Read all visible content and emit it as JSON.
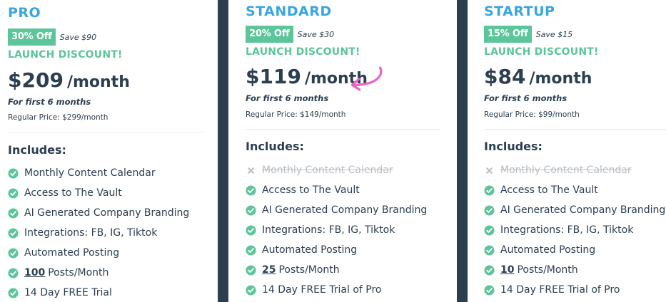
{
  "plans": [
    {
      "name": "PRO",
      "discount_badge": "30% Off",
      "save_text": "Save $90",
      "launch": "LAUNCH DISCOUNT!",
      "price": "$209",
      "per": "/month",
      "first_months": "For first 6 months",
      "regular": "Regular Price: $299/month",
      "includes": "Includes:",
      "features": [
        {
          "label": "Monthly Content Calendar",
          "enabled": true
        },
        {
          "label": "Access to The Vault",
          "enabled": true
        },
        {
          "label": "AI Generated Company Branding",
          "enabled": true
        },
        {
          "label": "Integrations: FB, IG, Tiktok",
          "enabled": true
        },
        {
          "label": "Automated Posting",
          "enabled": true
        },
        {
          "count": "100",
          "label": "Posts/Month",
          "enabled": true
        },
        {
          "label": "14 Day FREE Trial",
          "enabled": true
        }
      ]
    },
    {
      "name": "STANDARD",
      "discount_badge": "20% Off",
      "save_text": "Save $30",
      "launch": "LAUNCH DISCOUNT!",
      "price": "$119",
      "per": "/month",
      "first_months": "For first 6 months",
      "regular": "Regular Price: $149/month",
      "includes": "Includes:",
      "features": [
        {
          "label": "Monthly Content Calendar",
          "enabled": false
        },
        {
          "label": "Access to The Vault",
          "enabled": true
        },
        {
          "label": "AI Generated Company Branding",
          "enabled": true
        },
        {
          "label": "Integrations: FB, IG, Tiktok",
          "enabled": true
        },
        {
          "label": "Automated Posting",
          "enabled": true
        },
        {
          "count": "25",
          "label": "Posts/Month",
          "enabled": true
        },
        {
          "label": "14 Day FREE Trial of Pro",
          "enabled": true
        }
      ]
    },
    {
      "name": "STARTUP",
      "discount_badge": "15% Off",
      "save_text": "Save $15",
      "launch": "LAUNCH DISCOUNT!",
      "price": "$84",
      "per": "/month",
      "first_months": "For first 6 months",
      "regular": "Regular Price: $99/month",
      "includes": "Includes:",
      "features": [
        {
          "label": "Monthly Content Calendar",
          "enabled": false
        },
        {
          "label": "Access to The Vault",
          "enabled": true
        },
        {
          "label": "AI Generated Company Branding",
          "enabled": true
        },
        {
          "label": "Integrations: FB, IG, Tiktok",
          "enabled": true
        },
        {
          "label": "Automated Posting",
          "enabled": true
        },
        {
          "count": "10",
          "label": "Posts/Month",
          "enabled": true
        },
        {
          "label": "14 Day FREE Trial of Pro",
          "enabled": true
        }
      ]
    }
  ],
  "icons": {
    "enabled": "check-circle-icon",
    "disabled": "x-icon",
    "highlight": "curved-arrow-icon"
  },
  "colors": {
    "plan_name": "#3aa6dd",
    "accent_green": "#5cc59a",
    "text_dark": "#2c3e50",
    "disabled_text": "#b9bec4",
    "highlight_arrow": "#e865c8",
    "background_dark": "#2c3e50"
  }
}
